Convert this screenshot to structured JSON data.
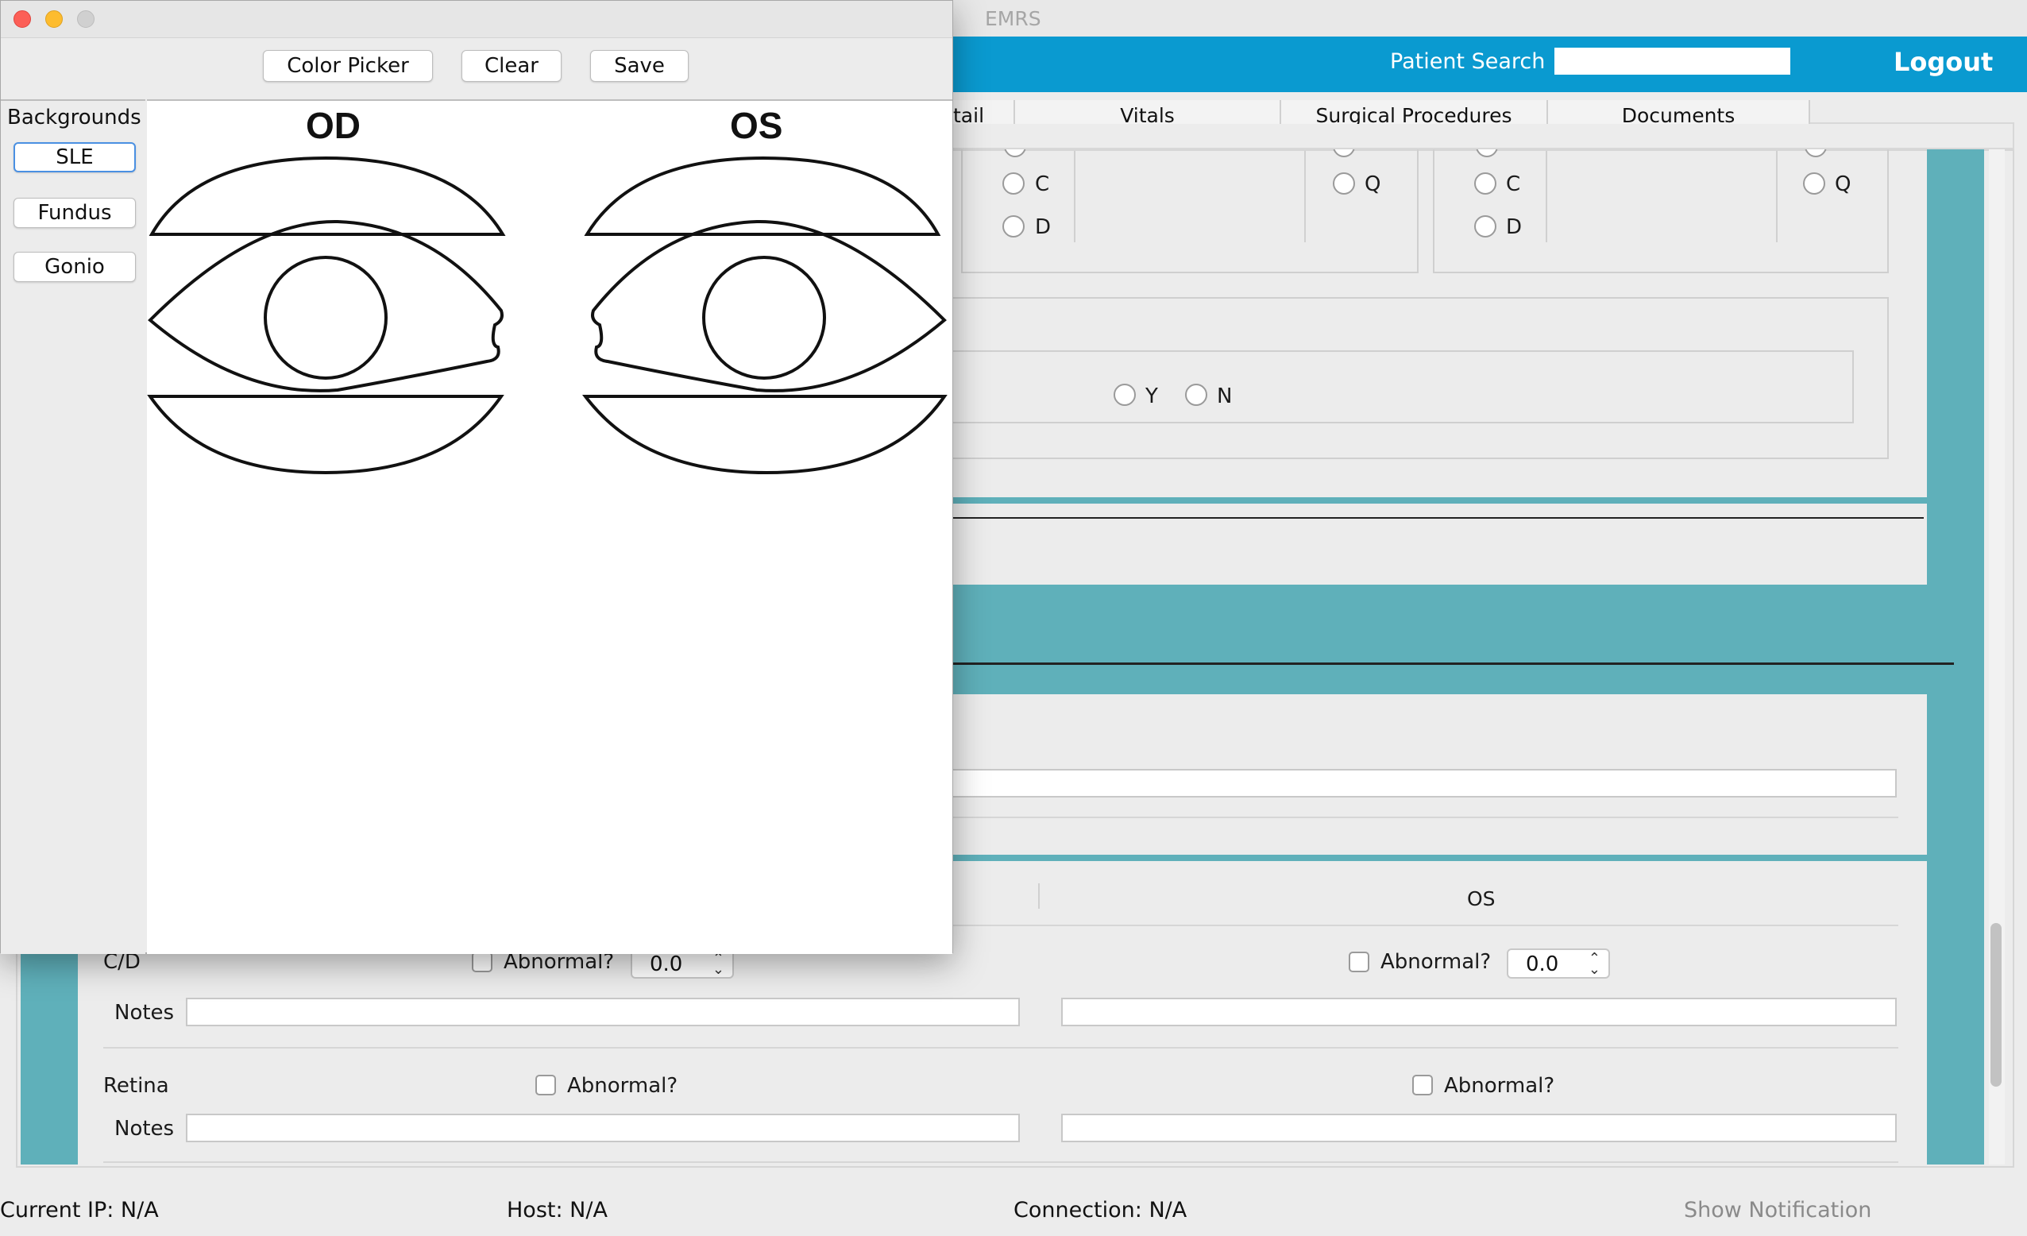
{
  "window": {
    "title": "EMRS"
  },
  "header": {
    "search_label": "Patient Search",
    "search_value": "",
    "logout_label": "Logout"
  },
  "tabs": [
    {
      "label": "tail"
    },
    {
      "label": "Vitals"
    },
    {
      "label": "Surgical Procedures"
    },
    {
      "label": "Documents"
    }
  ],
  "form": {
    "radio_c": "C",
    "radio_d": "D",
    "radio_q": "Q",
    "radio_y": "Y",
    "radio_n": "N",
    "os_header": "OS",
    "cd_label": "C/D",
    "abnormal_label": "Abnormal?",
    "cd_od_value": "0.0",
    "cd_os_value": "0.0",
    "notes_label": "Notes",
    "retina_label": "Retina"
  },
  "status_bar": {
    "current_ip": "Current IP: N/A",
    "host": "Host: N/A",
    "connection": "Connection: N/A",
    "show_notification": "Show Notification"
  },
  "drawing_window": {
    "toolbar": {
      "color_picker": "Color Picker",
      "clear": "Clear",
      "save": "Save"
    },
    "backgrounds_label": "Backgrounds",
    "background_buttons": [
      "SLE",
      "Fundus",
      "Gonio"
    ],
    "canvas": {
      "od_label": "OD",
      "os_label": "OS"
    }
  },
  "colors": {
    "header_blue": "#0a9ad0",
    "teal": "#5fb0ba",
    "selected_blue": "#4a90e2"
  }
}
